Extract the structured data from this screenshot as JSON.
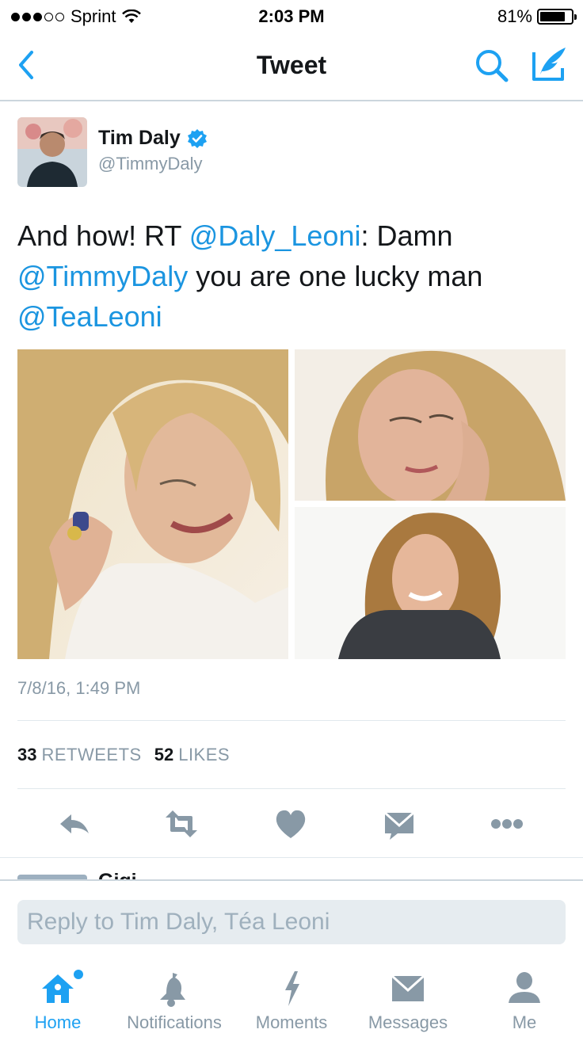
{
  "status_bar": {
    "carrier": "Sprint",
    "time": "2:03 PM",
    "battery": "81%",
    "battery_level": 0.81
  },
  "nav": {
    "title": "Tweet",
    "back_icon": "chevron-left-icon",
    "search_icon": "search-icon",
    "compose_icon": "compose-tweet-icon"
  },
  "tweet": {
    "author_name": "Tim Daly",
    "author_handle": "@TimmyDaly",
    "verified": true,
    "text_parts": {
      "p1": "And how! RT ",
      "m1": "@Daly_Leoni",
      "p2": ": Damn ",
      "m2": "@TimmyDaly",
      "p3": " you are one lucky man ",
      "m3": "@TeaLeoni"
    },
    "timestamp": "7/8/16, 1:49 PM",
    "retweets_count": "33",
    "retweets_label": "RETWEETS",
    "likes_count": "52",
    "likes_label": "LIKES"
  },
  "actions": [
    "reply-icon",
    "retweet-icon",
    "like-icon",
    "direct-message-icon",
    "more-icon"
  ],
  "next_reply": {
    "name": "Gigi"
  },
  "reply": {
    "placeholder": "Reply to Tim Daly, Téa Leoni"
  },
  "tabs": [
    {
      "label": "Home",
      "icon": "home-icon",
      "active": true
    },
    {
      "label": "Notifications",
      "icon": "bell-icon",
      "active": false
    },
    {
      "label": "Moments",
      "icon": "lightning-icon",
      "active": false
    },
    {
      "label": "Messages",
      "icon": "envelope-icon",
      "active": false
    },
    {
      "label": "Me",
      "icon": "person-icon",
      "active": false
    }
  ],
  "colors": {
    "accent": "#1da1f2",
    "mention": "#1b95e0",
    "muted": "#8899a6"
  }
}
